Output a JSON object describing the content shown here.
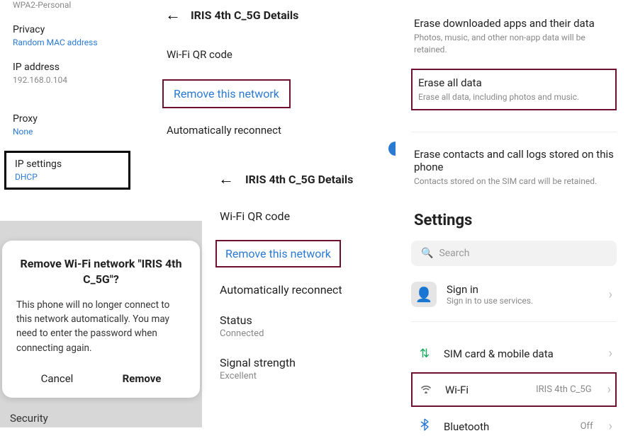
{
  "col1": {
    "security_value": "WPA2-Personal",
    "privacy_label": "Privacy",
    "privacy_value": "Random MAC address",
    "ip_label": "IP address",
    "ip_value": "192.168.0.104",
    "proxy_label": "Proxy",
    "proxy_value": "None",
    "ipsettings_label": "IP settings",
    "ipsettings_value": "DHCP"
  },
  "dialog": {
    "title": "Remove Wi-Fi network \"IRIS 4th C_5G\"?",
    "body": "This phone will no longer connect to this network automatically. You may need to enter the password when connecting again.",
    "cancel": "Cancel",
    "remove": "Remove",
    "security_row": "Security"
  },
  "col2": {
    "title": "IRIS 4th C_5G Details",
    "qr": "Wi-Fi QR code",
    "remove": "Remove this network",
    "auto": "Automatically reconnect"
  },
  "col3": {
    "title": "IRIS 4th C_5G Details",
    "qr": "Wi-Fi QR code",
    "remove": "Remove this network",
    "auto": "Automatically reconnect",
    "status_label": "Status",
    "status_value": "Connected",
    "signal_label": "Signal strength",
    "signal_value": "Excellent"
  },
  "col4": {
    "erase_apps_label": "Erase downloaded apps and their data",
    "erase_apps_sub": "Photos, music, and other non-app data will be retained.",
    "erase_all_label": "Erase all data",
    "erase_all_sub": "Erase all data, including photos and music.",
    "erase_contacts_label": "Erase contacts and call logs stored on this phone",
    "erase_contacts_sub": "Contacts stored on the SIM card will be retained.",
    "settings_title": "Settings",
    "search_placeholder": "Search",
    "signin_label": "Sign in",
    "signin_sub": "Sign in to use services.",
    "sim_label": "SIM card & mobile data",
    "wifi_label": "Wi-Fi",
    "wifi_value": "IRIS 4th C_5G",
    "bt_label": "Bluetooth",
    "bt_value": "Off"
  }
}
